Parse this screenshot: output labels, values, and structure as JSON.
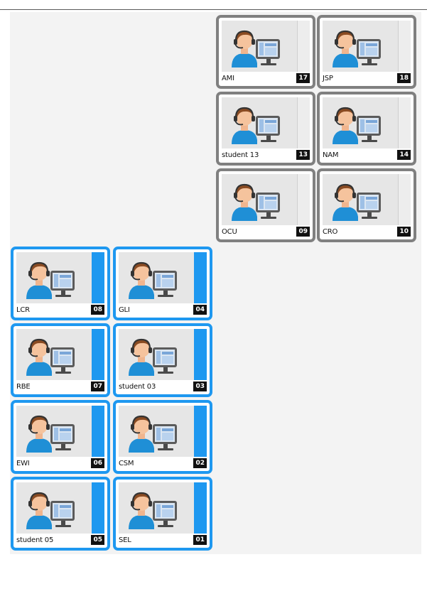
{
  "tiles": [
    {
      "name": "AMI",
      "number": "17",
      "group": "gray"
    },
    {
      "name": "JSP",
      "number": "18",
      "group": "gray"
    },
    {
      "name": "student 13",
      "number": "13",
      "group": "gray"
    },
    {
      "name": "NAM",
      "number": "14",
      "group": "gray"
    },
    {
      "name": "OCU",
      "number": "09",
      "group": "gray"
    },
    {
      "name": "CRO",
      "number": "10",
      "group": "gray"
    },
    {
      "name": "LCR",
      "number": "08",
      "group": "blue"
    },
    {
      "name": "GLI",
      "number": "04",
      "group": "blue"
    },
    {
      "name": "RBE",
      "number": "07",
      "group": "blue"
    },
    {
      "name": "student 03",
      "number": "03",
      "group": "blue"
    },
    {
      "name": "EWI",
      "number": "06",
      "group": "blue"
    },
    {
      "name": "CSM",
      "number": "02",
      "group": "blue"
    },
    {
      "name": "student 05",
      "number": "05",
      "group": "blue"
    },
    {
      "name": "SEL",
      "number": "01",
      "group": "blue"
    }
  ],
  "colors": {
    "selected_border": "#1e98f0",
    "unselected_border": "#808080",
    "background": "#f3f3f3"
  },
  "icon": "student-computer-icon"
}
